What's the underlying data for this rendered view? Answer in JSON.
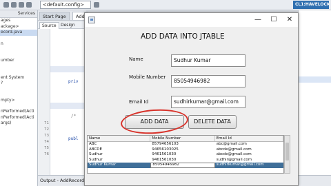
{
  "ide": {
    "run_config": "<default.config>",
    "badge": "CL1:HAVELOCKPAT",
    "left_panel_title": "Services",
    "left_items": [
      "ages",
      "ackage>",
      "ecord.java",
      "",
      "",
      "n",
      "",
      "",
      "",
      "umber",
      "",
      "",
      "ent System",
      "",
      "?",
      "",
      "",
      "mpty>",
      "",
      "nPerformed(Acti",
      "nPerformed(Acti",
      "args)"
    ],
    "tabs": [
      "Start Page",
      "Add"
    ],
    "source_tab": "Source",
    "design_tab": "Design",
    "gutter_numbers": [
      "",
      "",
      "",
      "",
      "",
      "",
      "",
      "",
      "",
      "",
      "",
      "",
      "",
      "",
      "",
      "",
      "71",
      "72",
      "73",
      "74",
      "75",
      "76"
    ],
    "code_words": {
      "priv": "priv",
      "public": "publ",
      "comment": "/*"
    },
    "output_title": "Output - AddRecord (ru"
  },
  "window": {
    "title_controls": {
      "minimize": "—",
      "maximize": "☐",
      "close": "✕"
    },
    "heading": "ADD DATA INTO JTABLE",
    "name_label": "Name",
    "name_value": "Sudhur Kumar",
    "mobile_label": "Mobile Number",
    "mobile_value": "85054946982",
    "email_label": "Email Id",
    "email_value": "sudhirkumar@gmail.com",
    "add_button": "ADD DATA",
    "delete_button": "DELETE DATA"
  },
  "table": {
    "headers": [
      "Name",
      "Mobile Number",
      "Email Id"
    ],
    "rows": [
      [
        "ABC",
        "85794656103",
        "abc@gmail.com"
      ],
      [
        "ABCDE",
        "94656103025",
        "abcde@gmail.com"
      ],
      [
        "Sudhur",
        "9461561030",
        "abcde@gmail.com"
      ],
      [
        "Sudhur",
        "9461561030",
        "sudhir@gmail.com"
      ],
      [
        "Sudhur Kumar",
        "85054946982",
        "sudhirkumar@gmail.com"
      ]
    ],
    "selected_row": 4
  },
  "colors": {
    "annotation_circle": "#d8322a",
    "selection": "#3f6f99"
  }
}
